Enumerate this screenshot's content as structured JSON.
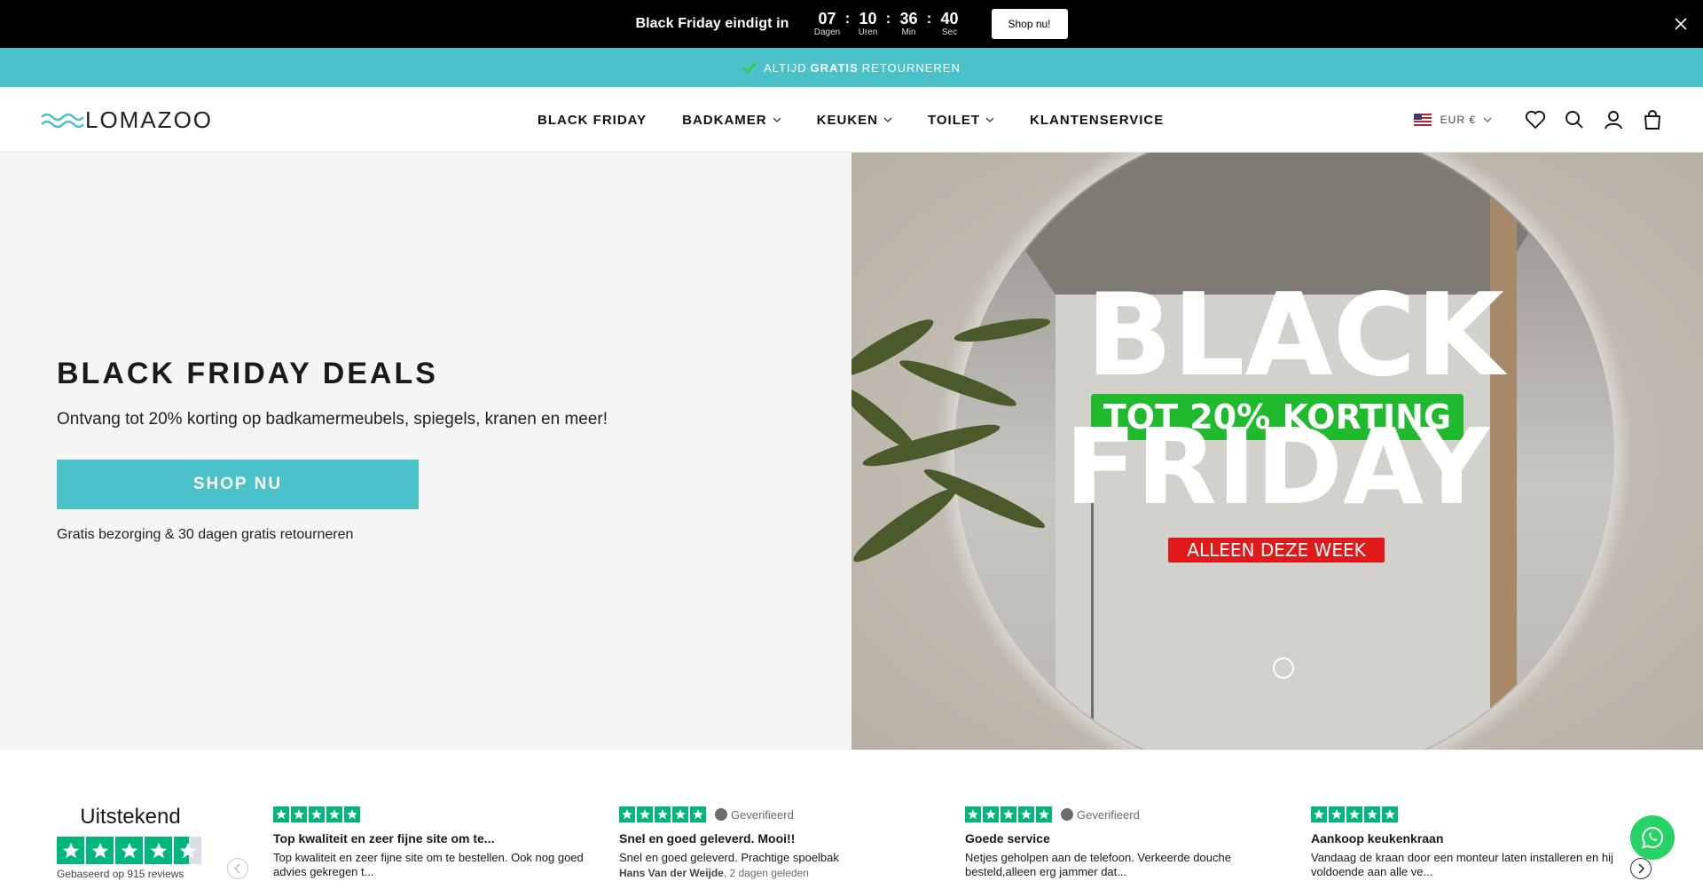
{
  "topbar": {
    "title": "Black Friday eindigt in",
    "countdown": [
      {
        "value": "07",
        "label": "Dagen"
      },
      {
        "value": "10",
        "label": "Uren"
      },
      {
        "value": "36",
        "label": "Min"
      },
      {
        "value": "40",
        "label": "Sec"
      }
    ],
    "separator": ":",
    "button_label": "Shop nu!",
    "close_icon": "close-icon"
  },
  "announcement": {
    "pre": "ALTIJD",
    "bold": "GRATIS",
    "post": "RETOURNEREN",
    "icon": "check-icon",
    "bg_color": "#4bc2c9"
  },
  "header": {
    "logo_text": "LOMAZOO",
    "nav": [
      {
        "label": "BLACK FRIDAY",
        "dropdown": false
      },
      {
        "label": "BADKAMER",
        "dropdown": true
      },
      {
        "label": "KEUKEN",
        "dropdown": true
      },
      {
        "label": "TOILET",
        "dropdown": true
      },
      {
        "label": "KLANTENSERVICE",
        "dropdown": false
      }
    ],
    "currency": "EUR €",
    "icons": [
      "heart-icon",
      "search-icon",
      "user-icon",
      "bag-icon"
    ]
  },
  "hero": {
    "title": "BLACK FRIDAY DEALS",
    "subtitle": "Ontvang tot 20% korting op badkamermeubels, spiegels, kranen en meer!",
    "button_label": "SHOP NU",
    "note": "Gratis bezorging & 30 dagen gratis retourneren",
    "image": {
      "line1": "BLACK",
      "badge": "TOT 20% KORTING",
      "line2": "FRIDAY",
      "tag": "ALLEEN DEZE WEEK"
    }
  },
  "reviews": {
    "summary_rating": "Uitstekend",
    "summary_stars": 4.5,
    "summary_based": "Gebaseerd op 915 reviews",
    "verified_label": "Geverifieerd",
    "items": [
      {
        "title": "Top kwaliteit en zeer fijne site om te...",
        "text": "Top kwaliteit en zeer fijne site om te bestellen. Ook nog goed advies gekregen t...",
        "author": "",
        "time": "",
        "verified": false
      },
      {
        "title": "Snel en goed geleverd. Mooi!!",
        "text": "Snel en goed geleverd. Prachtige spoelbak",
        "author": "Hans Van der Weijde",
        "time": "2 dagen geleden",
        "verified": true
      },
      {
        "title": "Goede service",
        "text": "Netjes geholpen aan de telefoon. Verkeerde douche besteld,alleen erg jammer dat...",
        "author": "",
        "time": "",
        "verified": true
      },
      {
        "title": "Aankoop keukenkraan",
        "text": "Vandaag de kraan door een monteur laten installeren en hij voldoende aan alle ve...",
        "author": "",
        "time": "",
        "verified": false
      }
    ]
  },
  "colors": {
    "accent": "#4bc2c9",
    "trustpilot": "#00b67a",
    "whatsapp": "#25d366"
  }
}
